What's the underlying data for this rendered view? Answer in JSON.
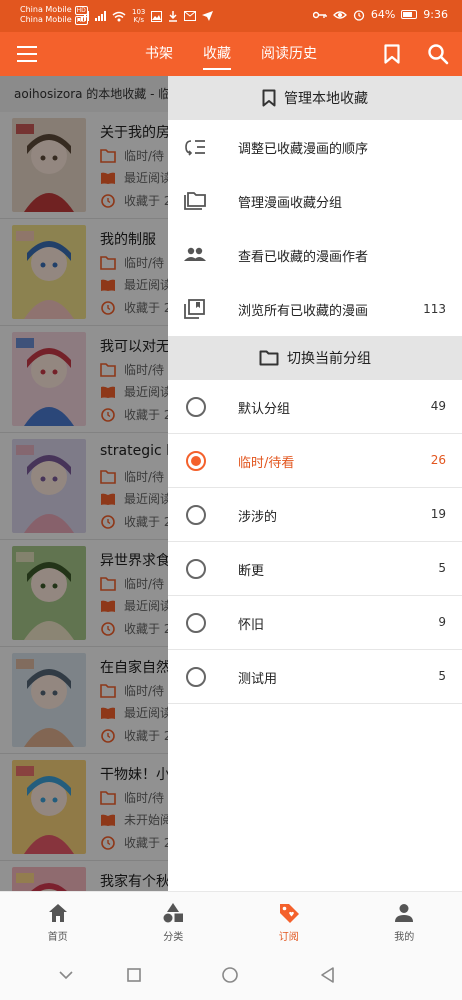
{
  "status_bar": {
    "carrier_1": "China Mobile",
    "carrier_2": "China Mobile",
    "hd": "HD",
    "net_speed": "103",
    "net_unit": "K/s",
    "battery": "64%",
    "time": "9:36"
  },
  "app_bar": {
    "tabs": [
      {
        "label": "书架"
      },
      {
        "label": "收藏"
      },
      {
        "label": "阅读历史"
      }
    ],
    "active_tab": "收藏"
  },
  "list": {
    "header": "aoihosizora 的本地收藏 - 临时/待看",
    "items": [
      {
        "title": "关于我的房",
        "group": "临时/待",
        "recent": "最近阅读",
        "saved": "收藏于 2"
      },
      {
        "title": "我的制服",
        "group": "临时/待",
        "recent": "最近阅读",
        "saved": "收藏于 2"
      },
      {
        "title": "我可以对无",
        "group": "临时/待",
        "recent": "最近阅读",
        "saved": "收藏于 2"
      },
      {
        "title": "strategic lo",
        "group": "临时/待",
        "recent": "最近阅读",
        "saved": "收藏于 2"
      },
      {
        "title": "异世界求食",
        "group": "临时/待",
        "recent": "最近阅读",
        "saved": "收藏于 2"
      },
      {
        "title": "在自家自然",
        "group": "临时/待",
        "recent": "最近阅读",
        "saved": "收藏于 2"
      },
      {
        "title": "干物妹！小",
        "group": "临时/待",
        "recent": "未开始阅读",
        "saved": "收藏于 2"
      },
      {
        "title": "我家有个秋",
        "group": "",
        "recent": "",
        "saved": ""
      }
    ]
  },
  "drawer": {
    "manage_header": "管理本地收藏",
    "actions": [
      {
        "label": "调整已收藏漫画的顺序",
        "icon": "reorder-icon",
        "count": ""
      },
      {
        "label": "管理漫画收藏分组",
        "icon": "folders-icon",
        "count": ""
      },
      {
        "label": "查看已收藏的漫画作者",
        "icon": "people-icon",
        "count": ""
      },
      {
        "label": "浏览所有已收藏的漫画",
        "icon": "library-icon",
        "count": "113"
      }
    ],
    "switch_header": "切换当前分组",
    "groups": [
      {
        "label": "默认分组",
        "count": "49",
        "selected": false
      },
      {
        "label": "临时/待看",
        "count": "26",
        "selected": true
      },
      {
        "label": "涉涉的",
        "count": "19",
        "selected": false
      },
      {
        "label": "断更",
        "count": "5",
        "selected": false
      },
      {
        "label": "怀旧",
        "count": "9",
        "selected": false
      },
      {
        "label": "测试用",
        "count": "5",
        "selected": false
      }
    ]
  },
  "bottom_nav": {
    "items": [
      {
        "label": "首页",
        "icon": "home-icon"
      },
      {
        "label": "分类",
        "icon": "category-icon"
      },
      {
        "label": "订阅",
        "icon": "tag-icon"
      },
      {
        "label": "我的",
        "icon": "person-icon"
      }
    ],
    "active": "订阅"
  },
  "colors": {
    "accent": "#f4612c",
    "status_bar": "#e2561f",
    "scrim": "rgba(0,0,0,0.42)"
  }
}
